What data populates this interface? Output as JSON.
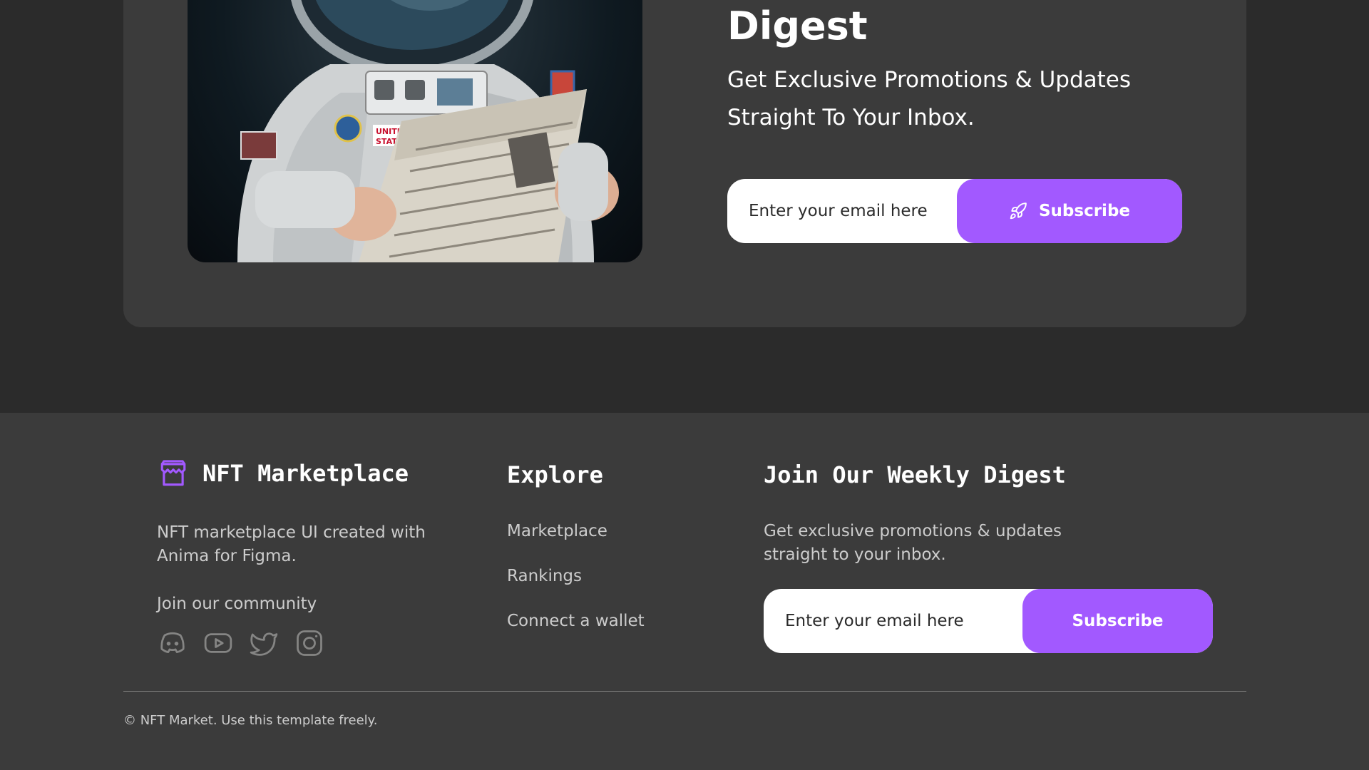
{
  "newsletter": {
    "title": "Digest",
    "subtitle": "Get Exclusive Promotions & Updates Straight To Your Inbox.",
    "email_placeholder": "Enter your email here",
    "subscribe_label": "Subscribe",
    "image_icon": "astronaut-reading-newspaper-image",
    "button_icon": "rocket-icon"
  },
  "footer": {
    "brand": {
      "icon": "storefront-icon",
      "name": "NFT Marketplace",
      "description": "NFT marketplace UI created with Anima for Figma."
    },
    "community": {
      "label": "Join our community",
      "socials": [
        "discord-icon",
        "youtube-icon",
        "twitter-icon",
        "instagram-icon"
      ]
    },
    "explore": {
      "heading": "Explore",
      "links": [
        "Marketplace",
        "Rankings",
        "Connect a wallet"
      ]
    },
    "join": {
      "heading": "Join Our Weekly Digest",
      "description": "Get exclusive promotions & updates straight to your inbox.",
      "email_placeholder": "Enter your email here",
      "subscribe_label": "Subscribe"
    },
    "copyright": "© NFT Market. Use this template freely."
  },
  "colors": {
    "accent": "#A259FF",
    "background": "#2B2B2B",
    "surface": "#3B3B3B",
    "text": "#FFFFFF",
    "muted_text": "#CCCCCC",
    "divider": "#858584"
  }
}
